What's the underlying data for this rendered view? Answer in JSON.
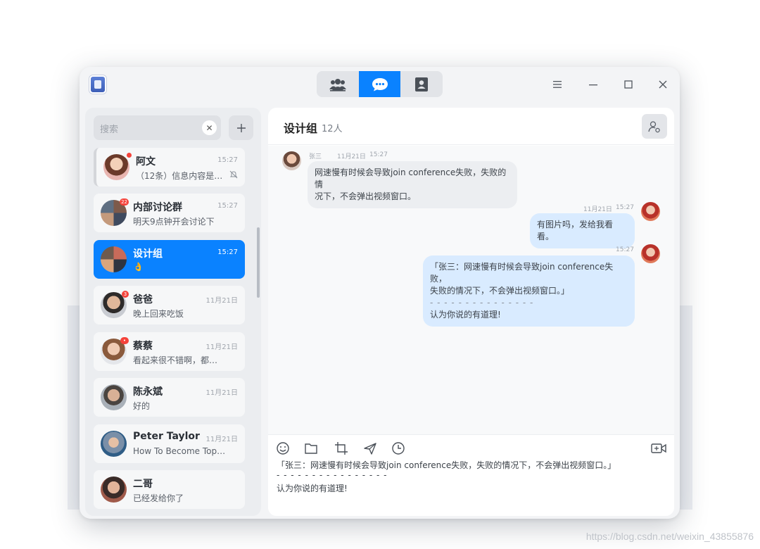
{
  "window": {
    "tabs": [
      {
        "icon": "contacts-group-icon",
        "active": false
      },
      {
        "icon": "chat-bubble-icon",
        "active": true
      },
      {
        "icon": "address-book-icon",
        "active": false
      }
    ],
    "controls": [
      "menu-icon",
      "minimize-icon",
      "maximize-icon",
      "close-icon"
    ]
  },
  "sidebar": {
    "search_placeholder": "搜索",
    "conversations": [
      {
        "name": "阿文",
        "preview": "（12条）信息内容是下…",
        "time": "15:27",
        "badge": "",
        "muted": true,
        "pinned": true,
        "active": false
      },
      {
        "name": "内部讨论群",
        "preview": "明天9点钟开会讨论下",
        "time": "15:27",
        "badge": "22",
        "muted": false,
        "pinned": false,
        "active": false
      },
      {
        "name": "设计组",
        "preview": "👌",
        "time": "15:27",
        "badge": "",
        "muted": false,
        "pinned": false,
        "active": true
      },
      {
        "name": "爸爸",
        "preview": "晚上回来吃饭",
        "time": "11月21日",
        "badge": "3",
        "muted": false,
        "pinned": false,
        "active": false
      },
      {
        "name": "蔡蔡",
        "preview": "看起来很不错啊，都…",
        "time": "11月21日",
        "badge": "•",
        "muted": false,
        "pinned": false,
        "active": false
      },
      {
        "name": "陈永斌",
        "preview": "好的",
        "time": "11月21日",
        "badge": "",
        "muted": false,
        "pinned": false,
        "active": false
      },
      {
        "name": "Peter Taylor",
        "preview": "How To Become Top…",
        "time": "11月21日",
        "badge": "",
        "muted": false,
        "pinned": false,
        "active": false
      },
      {
        "name": "二哥",
        "preview": "已经发给你了",
        "time": "",
        "badge": "",
        "muted": false,
        "pinned": false,
        "active": false
      }
    ]
  },
  "chat": {
    "title": "设计组",
    "member_count": "12人",
    "messages": [
      {
        "direction": "in",
        "sender": "张三",
        "date": "11月21日",
        "time": "15:27",
        "text_lines": [
          "网速慢有时候会导致join conference失败，失败的情",
          "况下，不会弹出视频窗口。"
        ]
      },
      {
        "direction": "out",
        "date": "11月21日",
        "time": "15:27",
        "text_lines": [
          "有图片吗，发给我看看。"
        ]
      },
      {
        "direction": "out",
        "time": "15:27",
        "quote_lines": [
          "「张三：网速慢有时候会导致join conference失败，",
          "失败的情况下，不会弹出视频窗口。」"
        ],
        "divider": "- - - - - - - - - - - - - - -",
        "reply": "认为你说的有道理!"
      }
    ]
  },
  "composer": {
    "tools": [
      "emoji-icon",
      "folder-icon",
      "crop-icon",
      "send-plane-icon",
      "clock-icon"
    ],
    "video_icon": "video-call-icon",
    "draft_quote": "「张三：网速慢有时候会导致join conference失败，失败的情况下，不会弹出视频窗口。」",
    "draft_divider": "- - - - - - - - - - - - - - - -",
    "draft_reply": "认为你说的有道理!"
  },
  "watermark": "https://blog.csdn.net/weixin_43855876",
  "colors": {
    "accent": "#0a82ff",
    "badge": "#f5433b",
    "bubble_out": "#d9ebff",
    "bubble_in": "#eceef1"
  }
}
